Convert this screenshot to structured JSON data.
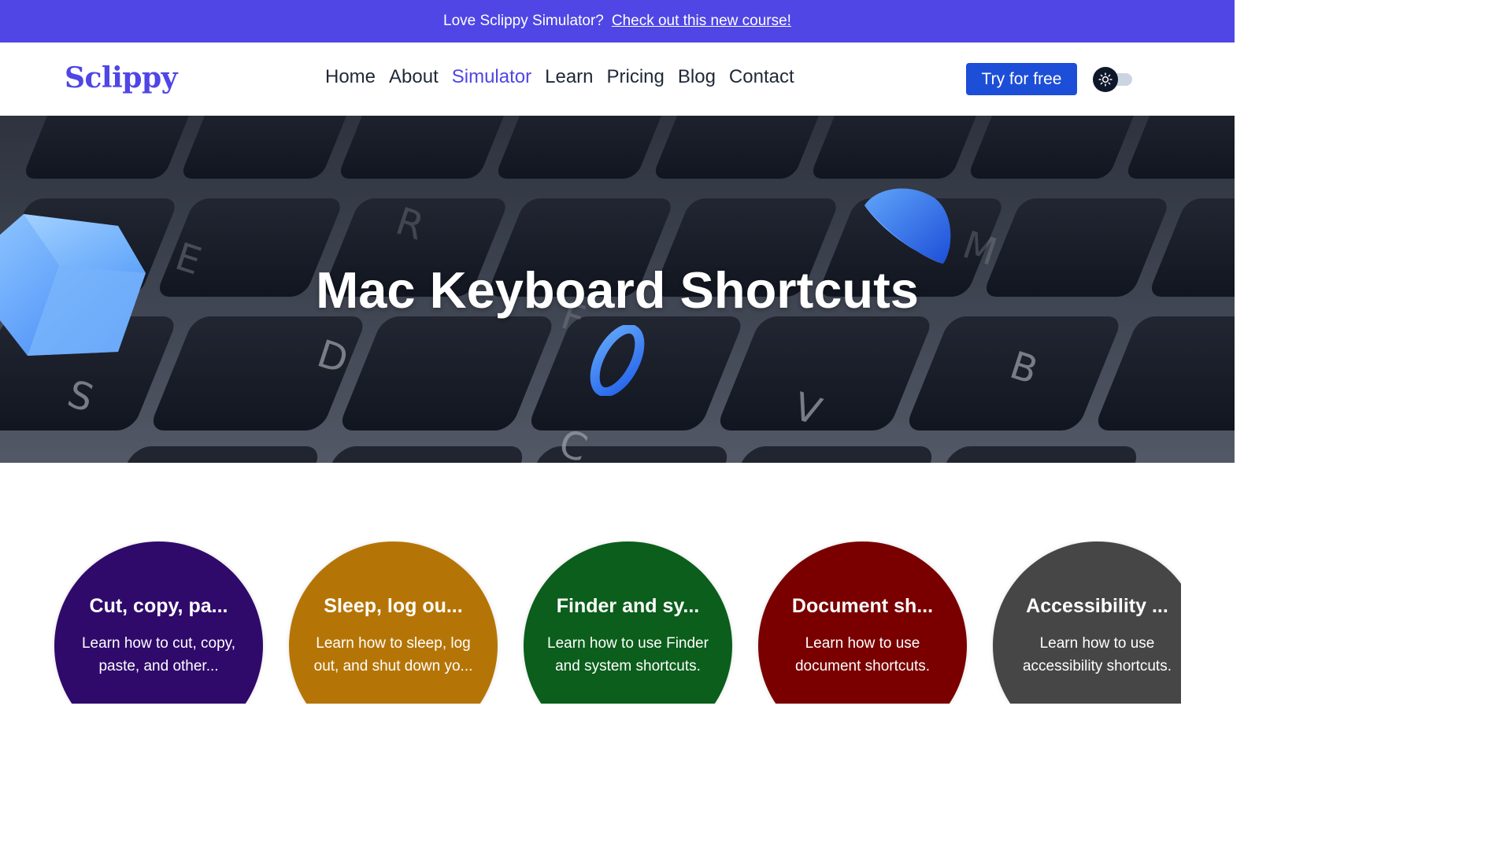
{
  "promo": {
    "text": "Love Sclippy Simulator?",
    "link_text": "Check out this new course!"
  },
  "nav": {
    "logo": "Sclippy",
    "links": [
      "Home",
      "About",
      "Simulator",
      "Learn",
      "Pricing",
      "Blog",
      "Contact"
    ],
    "active_link": "Simulator",
    "cta_label": "Try for free",
    "theme_icon": "sun-icon"
  },
  "hero": {
    "title": "Mac Keyboard Shortcuts",
    "key_letters": [
      "S",
      "D",
      "C",
      "V",
      "B",
      "E",
      "R",
      "F",
      "M"
    ]
  },
  "cards": [
    {
      "title": "Cut, copy, pa...",
      "description": "Learn how to cut, copy, paste, and other...",
      "color": "#2f0a6b"
    },
    {
      "title": "Sleep, log ou...",
      "description": "Learn how to sleep, log out, and shut down yo...",
      "color": "#b57506"
    },
    {
      "title": "Finder and sy...",
      "description": "Learn how to use Finder and system shortcuts.",
      "color": "#0b5e1b"
    },
    {
      "title": "Document sh...",
      "description": "Learn how to use document shortcuts.",
      "color": "#7a0000"
    },
    {
      "title": "Accessibility ...",
      "description": "Learn how to use accessibility shortcuts.",
      "color": "#464646"
    }
  ],
  "colors": {
    "brand": "#4f46e5",
    "promo_bg": "#4f46e5",
    "cta_bg": "#1d4ed8",
    "nav_text": "#1f2937"
  }
}
